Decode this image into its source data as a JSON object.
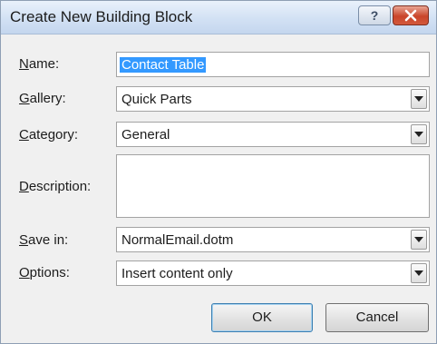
{
  "window": {
    "title": "Create New Building Block",
    "help_icon": "help-question-icon",
    "close_icon": "close-x-icon"
  },
  "fields": {
    "name": {
      "label_mnemonic": "N",
      "label_rest": "ame:",
      "value": "Contact Table"
    },
    "gallery": {
      "label_mnemonic": "G",
      "label_rest": "allery:",
      "value": "Quick Parts"
    },
    "category": {
      "label_mnemonic": "C",
      "label_rest": "ategory:",
      "value": "General"
    },
    "description": {
      "label_mnemonic": "D",
      "label_rest": "escription:",
      "value": ""
    },
    "save_in": {
      "label_mnemonic": "S",
      "label_rest": "ave in:",
      "value": "NormalEmail.dotm"
    },
    "options": {
      "label_mnemonic": "O",
      "label_rest": "ptions:",
      "value": "Insert content only"
    }
  },
  "buttons": {
    "ok_label": "OK",
    "cancel_label": "Cancel"
  },
  "colors": {
    "selection": "#3399ff",
    "close_button": "#c9452a"
  }
}
